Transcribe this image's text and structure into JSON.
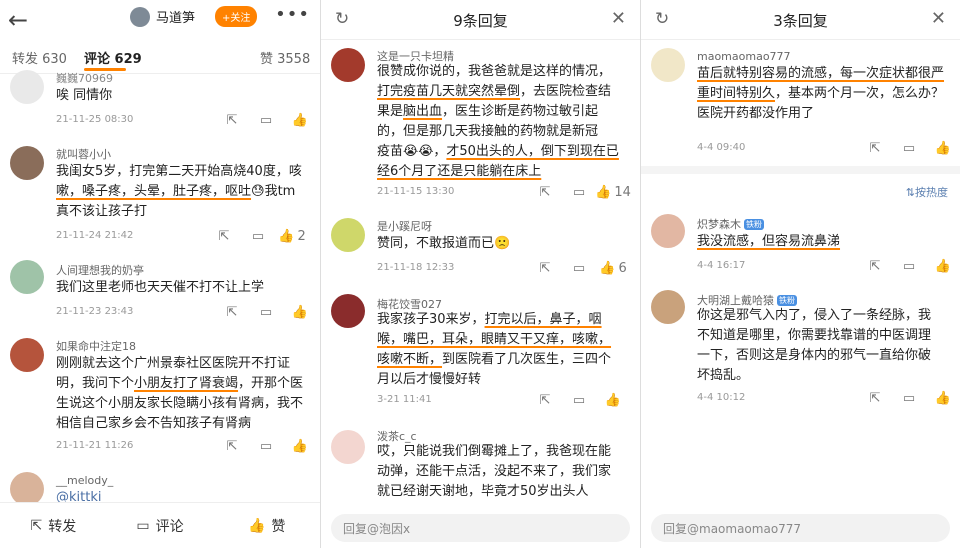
{
  "header": {
    "back_icon": "back-arrow-icon",
    "user_name": "马道笋",
    "follow_label": "+关注",
    "more_icon": "more-dots-icon"
  },
  "tabs": {
    "repost": "转发 630",
    "comment": "评论 629",
    "like": "赞 3558"
  },
  "feed": [
    {
      "nick": "巍巍70969",
      "text": "唉 同情你",
      "time": "21-11-25 08:30",
      "likes": ""
    },
    {
      "nick": "就叫蓉小小",
      "line1": "我闺女5岁，打完第二天开始高烧40度，咳",
      "line2a": "嗽，嗓子疼，头晕，肚子疼，呕吐",
      "line2b": "😓我tm",
      "line3": "真不该让孩子打",
      "time": "21-11-24 21:42",
      "likes": "2"
    },
    {
      "nick": "人间理想我的奶亭",
      "text": "我们这里老师也天天催不打不让上学",
      "time": "21-11-23 23:43",
      "likes": ""
    },
    {
      "nick": "如果命中注定18",
      "line1": "刚刚就去这个广州景泰社区医院开不打证",
      "line2a": "明，我问下个",
      "line2b": "小朋友打了肾衰竭",
      "line2c": "，开那个医",
      "line3": "生说这个小朋友家长隐瞒小孩有肾病，我不",
      "line4": "相信自己家乡会不告知孩子有肾病",
      "time": "21-11-21 11:26",
      "likes": ""
    },
    {
      "nick": "__melody_",
      "text": "@kittki"
    }
  ],
  "bottom_bar": {
    "repost": "转发",
    "comment": "评论",
    "like": "赞"
  },
  "dialog2": {
    "title": "9条回复",
    "reply_placeholder": "回复@泡因x",
    "items": [
      {
        "nick": "这是一只卡坦精",
        "l1": "很赞成你说的，我爸爸就是这样的情况，",
        "l2a": "打完疫苗几天就突然晕倒",
        "l2b": "，去医院检查结",
        "l3a": "果是",
        "l3b": "脑出血",
        "l3c": "，医生诊断是药物过敏引起",
        "l4": "的，但是那几天我接触的药物就是新冠",
        "l5a": "疫苗😭😭，",
        "l5b": "才50出头的人，倒下到现在已",
        "l6": "经6个月了还是只能躺在床上",
        "time": "21-11-15 13:30",
        "likes": "14"
      },
      {
        "nick": "是小蹊尼呀",
        "text": "赞同，不敢报道而已🙁",
        "time": "21-11-18 12:33",
        "likes": "6"
      },
      {
        "nick": "梅花饺雪027",
        "l1a": "我家孩子30来岁，",
        "l1b": "打完以后，鼻子，咽",
        "l2": "喉，嘴巴，耳朵，眼睛又干又痒，咳嗽，",
        "l3a": "咳嗽不断，",
        "l3b": "到医院看了几次医生，三四个",
        "l4": "月以后才慢慢好转",
        "time": "3-21 11:41",
        "likes": ""
      },
      {
        "nick": "泼茶c_c",
        "l1": "哎，只能说我们倒霉摊上了，我爸现在能",
        "l2": "动弹，还能干点活，没起不来了，我们家",
        "l3": "就已经谢天谢地，毕竟才50岁出头人"
      }
    ]
  },
  "dialog3": {
    "title": "3条回复",
    "reply_placeholder": "回复@maomaomao777",
    "sort_label": "按热度",
    "items": [
      {
        "nick": "maomaomao777",
        "l1a": "苗后就特别容易的流感，每一次症状都很严",
        "l2a": "重时间特别久",
        "l2b": "，基本两个月一次，怎么办？",
        "l3": "医院开药都没作用了",
        "time": "4-4 09:40",
        "likes": ""
      },
      {
        "nick": "炽梦森木",
        "badge": "铁粉",
        "text": "我没流感，但容易流鼻涕",
        "time": "4-4 16:17",
        "likes": ""
      },
      {
        "nick": "大明湖上戴哈猿",
        "badge": "铁粉",
        "l1": "你这是邪气入内了，侵入了一条经脉，我",
        "l2": "不知道是哪里，你需要找靠谱的中医调理",
        "l3": "一下，否则这是身体内的邪气一直给你破",
        "l4": "坏捣乱。",
        "time": "4-4 10:12",
        "likes": ""
      }
    ]
  },
  "colors": {
    "accent": "#ff8200",
    "link": "#4a6fa5"
  }
}
